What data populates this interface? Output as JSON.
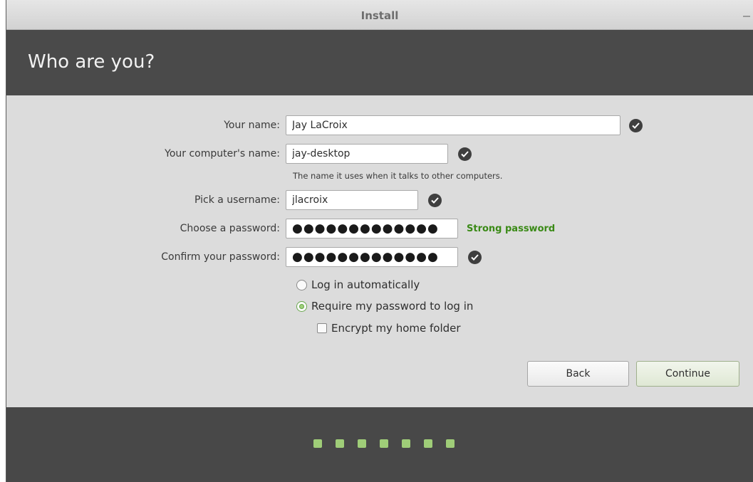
{
  "window": {
    "title": "Install"
  },
  "header": {
    "heading": "Who are you?"
  },
  "form": {
    "name": {
      "label": "Your name:",
      "value": "Jay LaCroix",
      "valid": true
    },
    "computer": {
      "label": "Your computer's name:",
      "value": "jay-desktop",
      "valid": true,
      "hint": "The name it uses when it talks to other computers."
    },
    "username": {
      "label": "Pick a username:",
      "value": "jlacroix",
      "valid": true
    },
    "password": {
      "label": "Choose a password:",
      "value": "●●●●●●●●●●●●●",
      "strength": "Strong password"
    },
    "confirm": {
      "label": "Confirm your password:",
      "value": "●●●●●●●●●●●●●",
      "valid": true
    }
  },
  "options": {
    "login_auto": {
      "label": "Log in automatically",
      "selected": false
    },
    "require_password": {
      "label": "Require my password to log in",
      "selected": true
    },
    "encrypt_home": {
      "label": "Encrypt my home folder",
      "checked": false
    }
  },
  "buttons": {
    "back": "Back",
    "continue": "Continue"
  },
  "progress": {
    "total_steps": 7
  },
  "colors": {
    "accent": "#9fcd78",
    "strength": "#3a8a16",
    "header_bg": "#4a4a4a"
  }
}
